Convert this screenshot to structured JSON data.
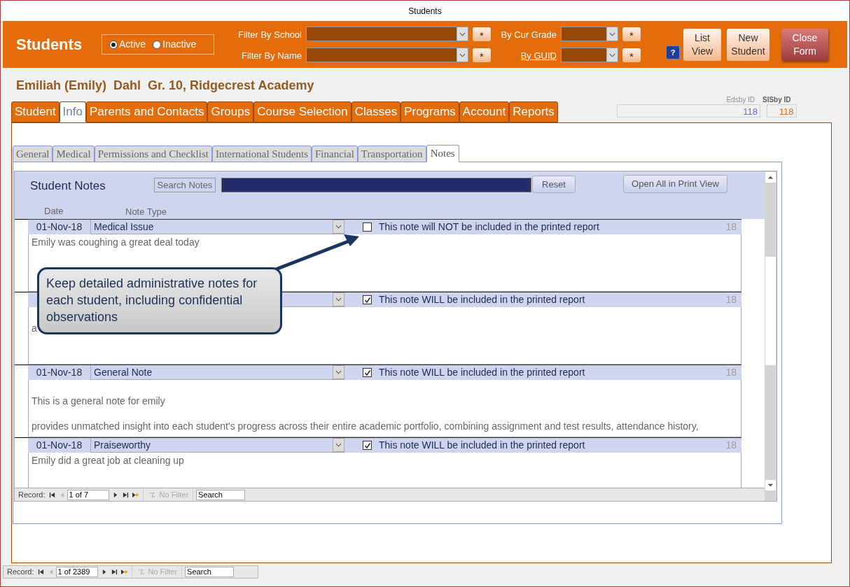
{
  "window": {
    "title": "Students"
  },
  "header": {
    "title": "Students",
    "status_options": [
      {
        "label": "Active",
        "selected": true
      },
      {
        "label": "Inactive",
        "selected": false
      }
    ],
    "filters": [
      {
        "label": "Filter By School",
        "kind": "plain",
        "clear": "*"
      },
      {
        "label": "Filter By Name",
        "kind": "plain",
        "clear": "*"
      },
      {
        "label": "By Cur Grade",
        "kind": "plain",
        "clear": "*"
      },
      {
        "label": "By GUID",
        "kind": "link",
        "clear": "*"
      }
    ],
    "help": "?",
    "buttons": [
      {
        "label": "List View",
        "kind": "normal"
      },
      {
        "label": "New Student",
        "kind": "normal"
      },
      {
        "label": "Close Form",
        "kind": "close"
      }
    ]
  },
  "student_heading": "Emiliah (Emily)  Dahl  Gr. 10, Ridgecrest Academy",
  "main_tabs": [
    {
      "label": "Student",
      "selected": false
    },
    {
      "label": "Info",
      "selected": true
    },
    {
      "label": "Parents and Contacts",
      "selected": false
    },
    {
      "label": "Groups",
      "selected": false
    },
    {
      "label": "Course Selection",
      "selected": false
    },
    {
      "label": "Classes",
      "selected": false
    },
    {
      "label": "Programs",
      "selected": false
    },
    {
      "label": "Account",
      "selected": false
    },
    {
      "label": "Reports",
      "selected": false
    }
  ],
  "ids": [
    {
      "label": "Edsby ID",
      "value": "118"
    },
    {
      "label": "SISby ID",
      "value": "118"
    }
  ],
  "sub_tabs": [
    {
      "label": "General",
      "selected": false
    },
    {
      "label": "Medical",
      "selected": false
    },
    {
      "label": "Permissions and Checklist",
      "selected": false
    },
    {
      "label": "International Students",
      "selected": false
    },
    {
      "label": "Financial",
      "selected": false
    },
    {
      "label": "Transportation",
      "selected": false
    },
    {
      "label": "Notes",
      "selected": true
    }
  ],
  "notes": {
    "title": "Student Notes",
    "search_label": "Search Notes",
    "reset_button": "Reset",
    "print_button": "Open All in Print View",
    "columns": [
      "Date",
      "Note Type"
    ],
    "records": [
      {
        "date": "01-Nov-18",
        "type": "Medical Issue",
        "included": false,
        "included_text": "This note will NOT be included in the printed report",
        "count": "18",
        "body": [
          "Emily was coughing a great deal today"
        ]
      },
      {
        "included": true,
        "included_text": "This note WILL be included in the printed report",
        "count": "18",
        "leading_blank": true,
        "body": [
          "a"
        ]
      },
      {
        "date": "01-Nov-18",
        "type": "General Note",
        "included": true,
        "included_text": "This note WILL be included in the printed report",
        "count": "18",
        "leading_blank": true,
        "body": [
          "This is a general note for emily",
          "provides unmatched insight into each student's progress across their entire academic portfolio, combining assignment and test results, attendance history,"
        ]
      },
      {
        "date": "01-Nov-18",
        "type": "Praiseworthy",
        "included": true,
        "included_text": "This note WILL be included in the printed report",
        "count": "18",
        "body": [
          "Emily did a great job at cleaning up"
        ]
      }
    ],
    "record_nav": {
      "label": "Record:",
      "position": "1 of 7",
      "filter": "No Filter",
      "search": "Search"
    }
  },
  "callout": "Keep detailed administrative notes for each student, including confidential observations",
  "record_nav": {
    "label": "Record:",
    "position": "1 of 2389",
    "filter": "No Filter",
    "search": "Search"
  }
}
